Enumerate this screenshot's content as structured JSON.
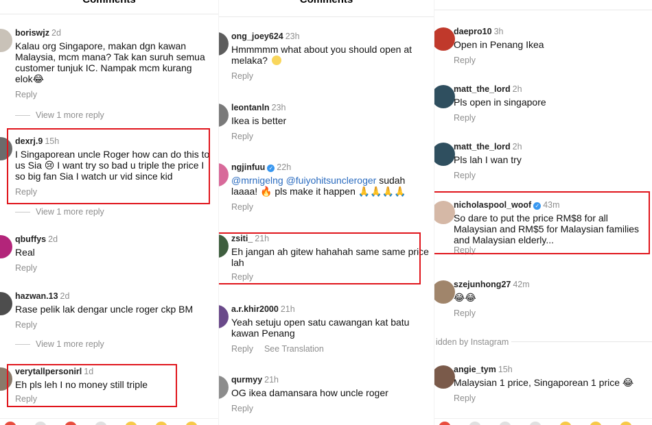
{
  "panels": [
    {
      "title": "Comments",
      "comments": [
        {
          "user": "boriswjz",
          "time": "2d",
          "text": "Kalau org Singapore, makan dgn kawan Malaysia, mcm mana? Tak kan suruh semua customer tunjuk IC. Nampak mcm kurang elok😂",
          "reply": "Reply",
          "more": "View 1 more reply"
        },
        {
          "user": "dexrj.9",
          "time": "15h",
          "text": "I Singaporean uncle Roger how can do this to us Sia 😢 I want try so bad u triple the price I so big fan Sia I watch ur vid since kid",
          "reply": "Reply",
          "more": "View 1 more reply"
        },
        {
          "user": "qbuffys",
          "time": "2d",
          "text": "Real",
          "reply": "Reply"
        },
        {
          "user": "hazwan.13",
          "time": "2d",
          "text": "Rase pelik lak dengar uncle roger ckp BM",
          "reply": "Reply",
          "more": "View 1 more reply"
        },
        {
          "user": "verytallpersonirl",
          "time": "1d",
          "text": "Eh pls leh I no money still triple",
          "reply": "Reply"
        }
      ]
    },
    {
      "title": "Comments",
      "comments": [
        {
          "user": "ong_joey624",
          "time": "23h",
          "text": "Hmmmmm what about you should open at melaka? ",
          "reply": "Reply"
        },
        {
          "user": "leontanln",
          "time": "23h",
          "text": "Ikea is better",
          "reply": "Reply"
        },
        {
          "user": "ngjinfuu",
          "time": "22h",
          "mention1": "@mrnigelng",
          "mention2": "@fuiyohitsuncleroger",
          "text_after": " sudah laaaa! 🔥 pls make it happen 🙏🙏🙏🙏",
          "reply": "Reply"
        },
        {
          "user": "zsiti_",
          "time": "21h",
          "text": "Eh jangan ah gitew hahahah same same price lah",
          "reply": "Reply"
        },
        {
          "user": "a.r.khir2000",
          "time": "21h",
          "text": "Yeah setuju open satu cawangan kat batu kawan Penang",
          "reply": "Reply",
          "translation": "See Translation"
        },
        {
          "user": "qurmyy",
          "time": "21h",
          "text": "OG ikea damansara how uncle roger",
          "reply": "Reply"
        }
      ]
    },
    {
      "comments": [
        {
          "user": "daepro10",
          "time": "3h",
          "text": "Open in Penang Ikea",
          "reply": "Reply"
        },
        {
          "user": "matt_the_lord",
          "time": "2h",
          "text": "Pls open in singapore",
          "reply": "Reply"
        },
        {
          "user": "matt_the_lord",
          "time": "2h",
          "text": "Pls lah I wan try",
          "reply": "Reply"
        },
        {
          "user": "nicholaspool_woof",
          "time": "43m",
          "text": "So dare to put the price RM$8 for all Malaysian and RM$5 for Malaysian families and Malaysian elderly...",
          "reply": "Reply"
        },
        {
          "user": "szejunhong27",
          "time": "42m",
          "text": "😂😂",
          "reply": "Reply"
        },
        {
          "user": "angie_tym",
          "time": "15h",
          "text": "Malaysian 1 price, Singaporean 1 price 😂",
          "reply": "Reply"
        }
      ],
      "hidden_note": "idden by Instagram"
    }
  ],
  "colors": {
    "highlight": "#e0141b",
    "verified": "#3897f0",
    "mention": "#2a6bbf"
  }
}
